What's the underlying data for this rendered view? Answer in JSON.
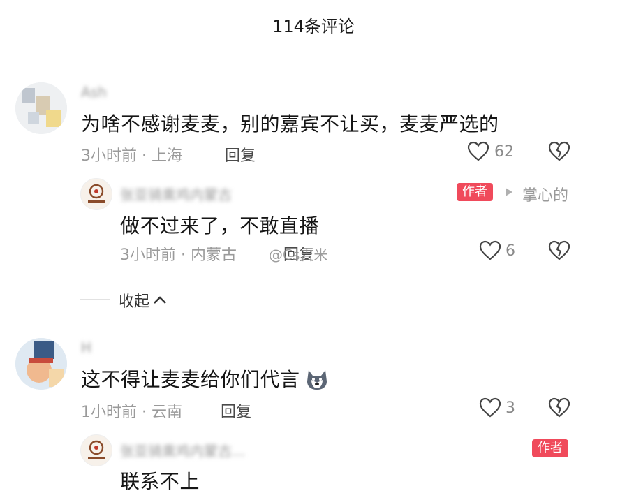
{
  "header": {
    "title": "114条评论"
  },
  "comments": [
    {
      "username": "Ash",
      "text": "为啥不感谢麦麦，别的嘉宾不让买，麦麦严选的",
      "meta": "3小时前 · 上海",
      "reply_label": "回复",
      "like_count": "62",
      "replies": [
        {
          "username": "张亚骑熏鸡内蒙古",
          "badge": "作者",
          "reply_to": "掌心的",
          "text": "做不过来了，不敢直播",
          "meta": "3小时前 · 内蒙古",
          "reply_label": "回复",
          "like_count": "6"
        }
      ],
      "collapse_label": "收起"
    },
    {
      "username": "H",
      "text": "这不得让麦麦给你们代言",
      "meta": "1小时前 · 云南",
      "reply_label": "回复",
      "like_count": "3",
      "replies": [
        {
          "username": "张亚骑熏鸡内蒙古...",
          "badge": "作者",
          "text": "联系不上"
        }
      ]
    }
  ],
  "watermark": "@Cs吉米",
  "icons": {
    "like": "heart-outline-icon",
    "dislike": "broken-heart-icon",
    "collapse": "chevron-up-icon",
    "reply_to": "triangle-right-icon",
    "emoji": "husky-emoji-icon"
  },
  "colors": {
    "badge": "#f04a5b",
    "meta": "#9a9a9a"
  }
}
